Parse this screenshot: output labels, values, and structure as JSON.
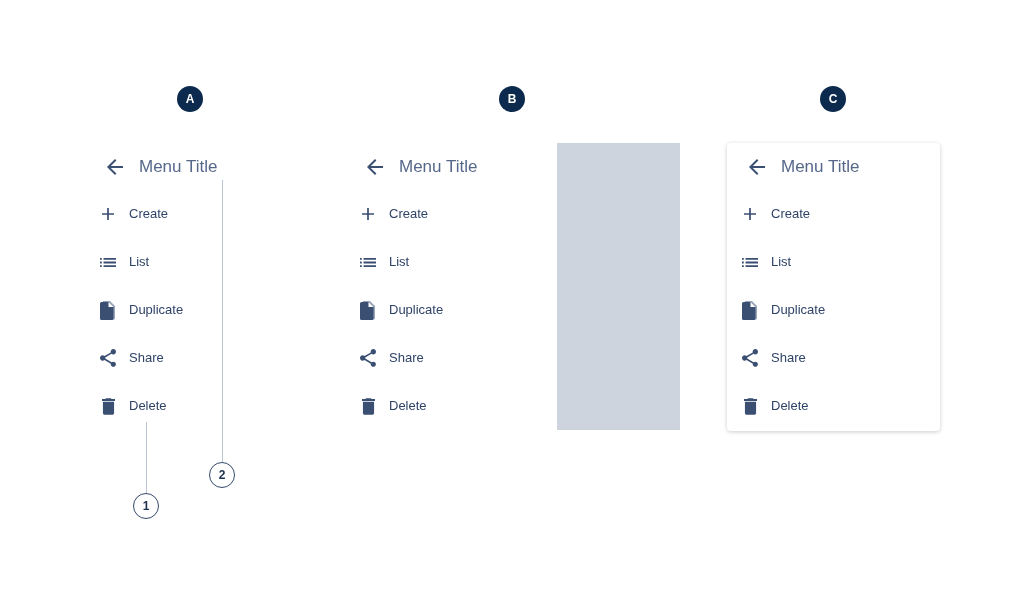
{
  "variants": [
    {
      "badge": "A",
      "kind": "plain",
      "menu": {
        "title": "Menu Title",
        "items": [
          {
            "kind": "create",
            "label": "Create"
          },
          {
            "kind": "list",
            "label": "List"
          },
          {
            "kind": "duplicate",
            "label": "Duplicate"
          },
          {
            "kind": "share",
            "label": "Share"
          },
          {
            "kind": "delete",
            "label": "Delete"
          }
        ]
      },
      "callouts": [
        {
          "number": "1",
          "kind": "item"
        },
        {
          "number": "2",
          "kind": "title"
        }
      ]
    },
    {
      "badge": "B",
      "kind": "overlay",
      "menu": {
        "title": "Menu Title",
        "items": [
          {
            "kind": "create",
            "label": "Create"
          },
          {
            "kind": "list",
            "label": "List"
          },
          {
            "kind": "duplicate",
            "label": "Duplicate"
          },
          {
            "kind": "share",
            "label": "Share"
          },
          {
            "kind": "delete",
            "label": "Delete"
          }
        ]
      }
    },
    {
      "badge": "C",
      "kind": "card",
      "menu": {
        "title": "Menu Title",
        "items": [
          {
            "kind": "create",
            "label": "Create"
          },
          {
            "kind": "list",
            "label": "List"
          },
          {
            "kind": "duplicate",
            "label": "Duplicate"
          },
          {
            "kind": "share",
            "label": "Share"
          },
          {
            "kind": "delete",
            "label": "Delete"
          }
        ]
      }
    }
  ]
}
